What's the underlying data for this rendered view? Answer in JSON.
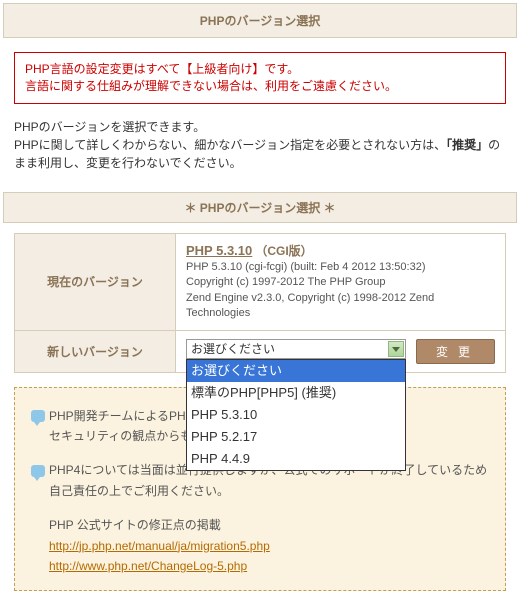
{
  "header": {
    "title": "PHPのバージョン選択"
  },
  "warning": {
    "line1": "PHP言語の設定変更はすべて【上級者向け】です。",
    "line2": "言語に関する仕組みが理解できない場合は、利用をご遠慮ください。"
  },
  "intro": {
    "line1": "PHPのバージョンを選択できます。",
    "line2_a": "PHPに関して詳しくわからない、細かなバージョン指定を必要とされない方は、",
    "line2_b": "「推奨」",
    "line2_c": "のまま利用し、変更を行わないでください。"
  },
  "section": {
    "title": "＊ PHPのバージョン選択 ＊"
  },
  "table": {
    "row1_label": "現在のバージョン",
    "row2_label": "新しいバージョン",
    "current": {
      "name": "PHP 5.3.10",
      "tag": "（CGI版）",
      "build": "PHP 5.3.10 (cgi-fcgi) (built: Feb 4 2012 13:50:32)",
      "copy1": "Copyright (c) 1997-2012 The PHP Group",
      "copy2": "Zend Engine v2.3.0, Copyright (c) 1998-2012 Zend Technologies"
    },
    "select": {
      "value": "お選びください",
      "options": [
        "お選びください",
        "標準のPHP[PHP5] (推奨)",
        "PHP 5.3.10",
        "PHP 5.2.17",
        "PHP 4.4.9"
      ]
    },
    "change_btn": "変更"
  },
  "notes": {
    "n1a": "PHP開発チームによるPHP4の",
    "n1b": "セキュリティの観点からも極力PHP",
    "n2a": "PHP4については当面は並行提供しますが、公式でのサポートが終了しているため",
    "n2b": "自己責任の上でご利用ください。",
    "linkhead": "PHP 公式サイトの修正点の掲載",
    "link1": "http://jp.php.net/manual/ja/migration5.php",
    "link2": "http://www.php.net/ChangeLog-5.php"
  }
}
